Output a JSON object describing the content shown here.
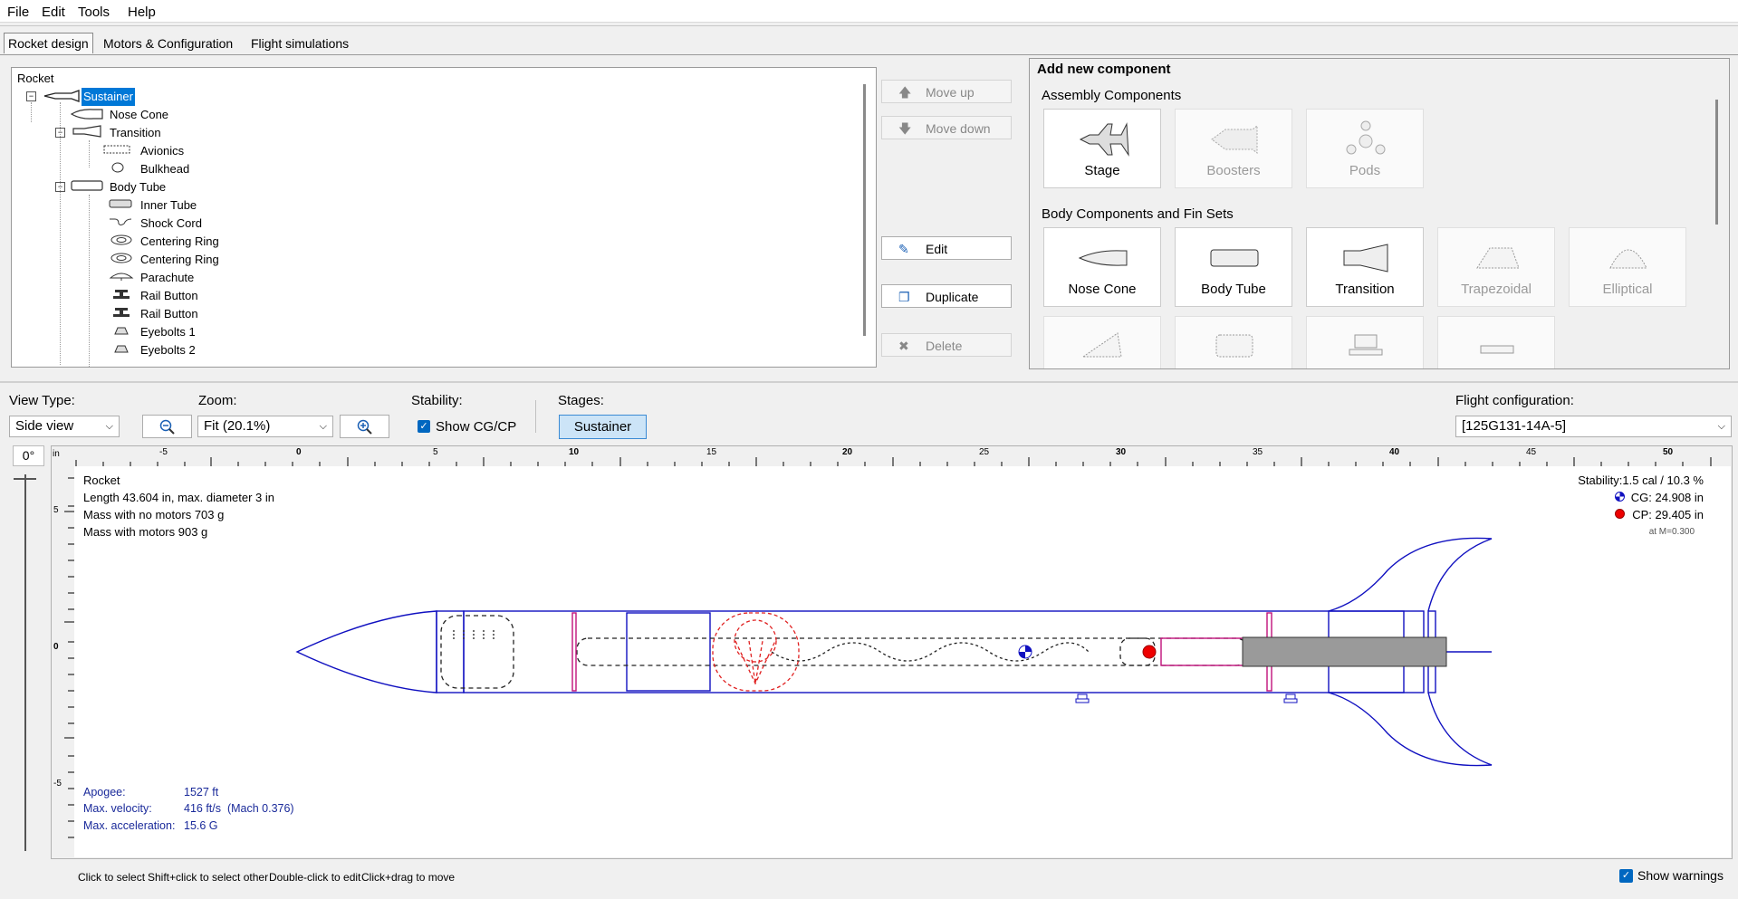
{
  "menu": [
    "File",
    "Edit",
    "Tools",
    "Help"
  ],
  "tabs": [
    "Rocket design",
    "Motors & Configuration",
    "Flight simulations"
  ],
  "tree": {
    "root": "Rocket",
    "items": [
      {
        "label": "Sustainer",
        "level": 0,
        "selected": true,
        "expanded": true
      },
      {
        "label": "Nose Cone",
        "level": 1
      },
      {
        "label": "Transition",
        "level": 1,
        "expanded": true
      },
      {
        "label": "Avionics",
        "level": 2
      },
      {
        "label": "Bulkhead",
        "level": 2
      },
      {
        "label": "Body Tube",
        "level": 1,
        "expanded": true
      },
      {
        "label": "Inner Tube",
        "level": 2
      },
      {
        "label": "Shock Cord",
        "level": 2
      },
      {
        "label": "Centering Ring",
        "level": 2
      },
      {
        "label": "Centering Ring",
        "level": 2
      },
      {
        "label": "Parachute",
        "level": 2
      },
      {
        "label": "Rail Button",
        "level": 2
      },
      {
        "label": "Rail Button",
        "level": 2
      },
      {
        "label": "Eyebolts 1",
        "level": 2
      },
      {
        "label": "Eyebolts 2",
        "level": 2
      }
    ]
  },
  "tree_actions": {
    "move_up": "Move up",
    "move_down": "Move down",
    "edit": "Edit",
    "duplicate": "Duplicate",
    "delete": "Delete"
  },
  "add_component": {
    "title": "Add new component",
    "assembly_header": "Assembly Components",
    "assembly": [
      {
        "label": "Stage",
        "enabled": true
      },
      {
        "label": "Boosters",
        "enabled": false
      },
      {
        "label": "Pods",
        "enabled": false
      }
    ],
    "body_header": "Body Components and Fin Sets",
    "body": [
      {
        "label": "Nose Cone",
        "enabled": true
      },
      {
        "label": "Body Tube",
        "enabled": true
      },
      {
        "label": "Transition",
        "enabled": true
      },
      {
        "label": "Trapezoidal",
        "enabled": false
      },
      {
        "label": "Elliptical",
        "enabled": false
      }
    ]
  },
  "controls": {
    "view_type_label": "View Type:",
    "view_type_value": "Side view",
    "zoom_label": "Zoom:",
    "zoom_value": "Fit (20.1%)",
    "stability_label": "Stability:",
    "show_cgcp_label": "Show CG/CP",
    "show_cgcp_checked": true,
    "stages_label": "Stages:",
    "stage_button": "Sustainer",
    "flight_config_label": "Flight configuration:",
    "flight_config_value": "[125G131-14A-5]",
    "rotation": "0°"
  },
  "ruler": {
    "unit": "in",
    "h_labels": [
      "-5",
      "0",
      "5",
      "10",
      "15",
      "20",
      "25",
      "30",
      "35",
      "40",
      "45",
      "50"
    ],
    "v_labels": [
      "5",
      "0",
      "-5"
    ]
  },
  "rocket_info": {
    "name": "Rocket",
    "length": "Length 43.604 in, max. diameter 3 in",
    "mass_no_motors": "Mass with no motors 703 g",
    "mass_with_motors": "Mass with motors 903 g",
    "stability": "Stability:1.5 cal / 10.3 %",
    "cg": "CG: 24.908 in",
    "cp": "CP: 29.405 in",
    "mach": "at M=0.300"
  },
  "flight_info": {
    "apogee_label": "Apogee:",
    "apogee_value": "1527 ft",
    "velocity_label": "Max. velocity:",
    "velocity_value": "416 ft/s  (Mach 0.376)",
    "accel_label": "Max. acceleration:",
    "accel_value": "15.6 G"
  },
  "status_hints": [
    "Click to select",
    "Shift+click to select other",
    "Double-click to edit",
    "Click+drag to move"
  ],
  "show_warnings": {
    "label": "Show warnings",
    "checked": true
  },
  "colors": {
    "selection": "#0078d7",
    "rocket_outline": "#1010c0",
    "internal": "#222222",
    "parachute": "#e02020",
    "ring": "#c0107a",
    "motor": "#909090"
  }
}
